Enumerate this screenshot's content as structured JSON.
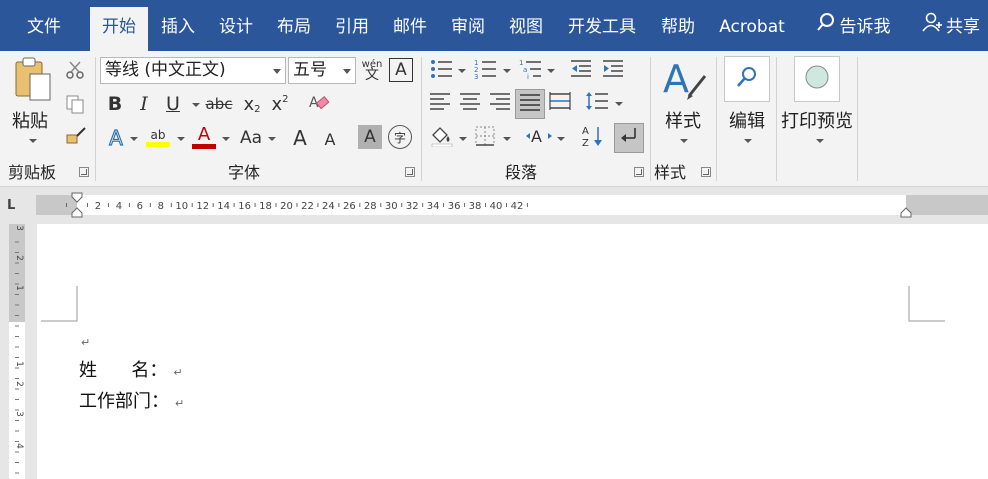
{
  "tabs": [
    {
      "label": "文件"
    },
    {
      "label": "开始"
    },
    {
      "label": "插入"
    },
    {
      "label": "设计"
    },
    {
      "label": "布局"
    },
    {
      "label": "引用"
    },
    {
      "label": "邮件"
    },
    {
      "label": "审阅"
    },
    {
      "label": "视图"
    },
    {
      "label": "开发工具"
    },
    {
      "label": "帮助"
    },
    {
      "label": "Acrobat"
    }
  ],
  "tell_me": "告诉我",
  "share": "共享",
  "clipboard": {
    "paste_label": "粘贴",
    "group_label": "剪贴板"
  },
  "font": {
    "name": "等线 (中文正文)",
    "size": "五号",
    "group_label": "字体",
    "phonetic_top": "wén",
    "phonetic_bottom": "文",
    "bold": "B",
    "italic": "I",
    "underline": "U",
    "strike": "abc",
    "sub": "x",
    "sup": "x",
    "text_effect": "A",
    "highlight": "ab",
    "font_color": "A",
    "change_case": "Aa",
    "grow": "A",
    "shrink": "A",
    "char_shade": "A",
    "enclose": "字"
  },
  "paragraph": {
    "group_label": "段落"
  },
  "styles": {
    "label": "样式",
    "group_label": "样式"
  },
  "editing": {
    "label": "编辑"
  },
  "print_preview": {
    "label": "打印预览"
  },
  "ruler": {
    "labels": [
      "2",
      "4",
      "6",
      "8",
      "10",
      "12",
      "14",
      "16",
      "18",
      "20",
      "22",
      "24",
      "26",
      "28",
      "30",
      "32",
      "34",
      "36",
      "38",
      "40",
      "42"
    ],
    "tab_selector": "L"
  },
  "vruler": {
    "labels": [
      "3",
      "2",
      "1",
      "1",
      "2",
      "3",
      "4"
    ]
  },
  "document": {
    "line1": "姓      名：",
    "line2": "工作部门：",
    "mark": "↵"
  },
  "colors": {
    "ribbon_blue": "#2b579a",
    "highlight": "#ffff00",
    "font_red": "#c00000"
  }
}
